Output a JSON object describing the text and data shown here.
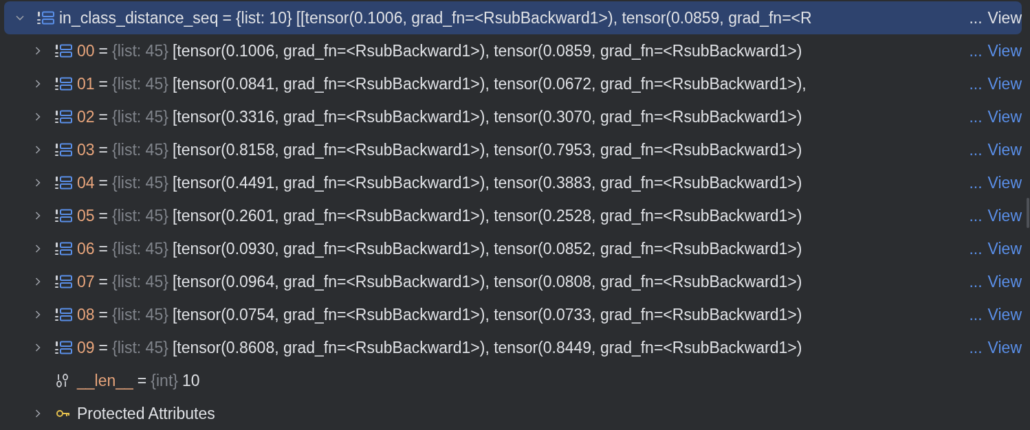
{
  "root": {
    "kind": "list",
    "name": "in_class_distance_seq",
    "separator": "=",
    "type": "{list: 10}",
    "value": "[[tensor(0.1006, grad_fn=<RsubBackward1>), tensor(0.0859, grad_fn=<R",
    "ellipsis": "...",
    "link": "View",
    "expanded": true,
    "selected": true,
    "children": [
      {
        "kind": "list",
        "name": "00",
        "separator": "=",
        "type": "{list: 45}",
        "value": "[tensor(0.1006, grad_fn=<RsubBackward1>), tensor(0.0859, grad_fn=<RsubBackward1>)",
        "ellipsis": "...",
        "link": "View",
        "expanded": false,
        "selected": false
      },
      {
        "kind": "list",
        "name": "01",
        "separator": "=",
        "type": "{list: 45}",
        "value": "[tensor(0.0841, grad_fn=<RsubBackward1>), tensor(0.0672, grad_fn=<RsubBackward1>),",
        "ellipsis": "...",
        "link": "View",
        "expanded": false,
        "selected": false
      },
      {
        "kind": "list",
        "name": "02",
        "separator": "=",
        "type": "{list: 45}",
        "value": "[tensor(0.3316, grad_fn=<RsubBackward1>), tensor(0.3070, grad_fn=<RsubBackward1>)",
        "ellipsis": "...",
        "link": "View",
        "expanded": false,
        "selected": false
      },
      {
        "kind": "list",
        "name": "03",
        "separator": "=",
        "type": "{list: 45}",
        "value": "[tensor(0.8158, grad_fn=<RsubBackward1>), tensor(0.7953, grad_fn=<RsubBackward1>)",
        "ellipsis": "...",
        "link": "View",
        "expanded": false,
        "selected": false
      },
      {
        "kind": "list",
        "name": "04",
        "separator": "=",
        "type": "{list: 45}",
        "value": "[tensor(0.4491, grad_fn=<RsubBackward1>), tensor(0.3883, grad_fn=<RsubBackward1>)",
        "ellipsis": "...",
        "link": "View",
        "expanded": false,
        "selected": false
      },
      {
        "kind": "list",
        "name": "05",
        "separator": "=",
        "type": "{list: 45}",
        "value": "[tensor(0.2601, grad_fn=<RsubBackward1>), tensor(0.2528, grad_fn=<RsubBackward1>)",
        "ellipsis": "...",
        "link": "View",
        "expanded": false,
        "selected": false
      },
      {
        "kind": "list",
        "name": "06",
        "separator": "=",
        "type": "{list: 45}",
        "value": "[tensor(0.0930, grad_fn=<RsubBackward1>), tensor(0.0852, grad_fn=<RsubBackward1>)",
        "ellipsis": "...",
        "link": "View",
        "expanded": false,
        "selected": false
      },
      {
        "kind": "list",
        "name": "07",
        "separator": "=",
        "type": "{list: 45}",
        "value": "[tensor(0.0964, grad_fn=<RsubBackward1>), tensor(0.0808, grad_fn=<RsubBackward1>)",
        "ellipsis": "...",
        "link": "View",
        "expanded": false,
        "selected": false
      },
      {
        "kind": "list",
        "name": "08",
        "separator": "=",
        "type": "{list: 45}",
        "value": "[tensor(0.0754, grad_fn=<RsubBackward1>), tensor(0.0733, grad_fn=<RsubBackward1>)",
        "ellipsis": "...",
        "link": "View",
        "expanded": false,
        "selected": false
      },
      {
        "kind": "list",
        "name": "09",
        "separator": "=",
        "type": "{list: 45}",
        "value": "[tensor(0.8608, grad_fn=<RsubBackward1>), tensor(0.8449, grad_fn=<RsubBackward1>)",
        "ellipsis": "...",
        "link": "View",
        "expanded": false,
        "selected": false
      },
      {
        "kind": "int",
        "name": "__len__",
        "separator": "=",
        "type": "{int}",
        "value": "10",
        "selected": false
      },
      {
        "kind": "protected",
        "name": "Protected Attributes",
        "expanded": false,
        "selected": false
      }
    ]
  }
}
